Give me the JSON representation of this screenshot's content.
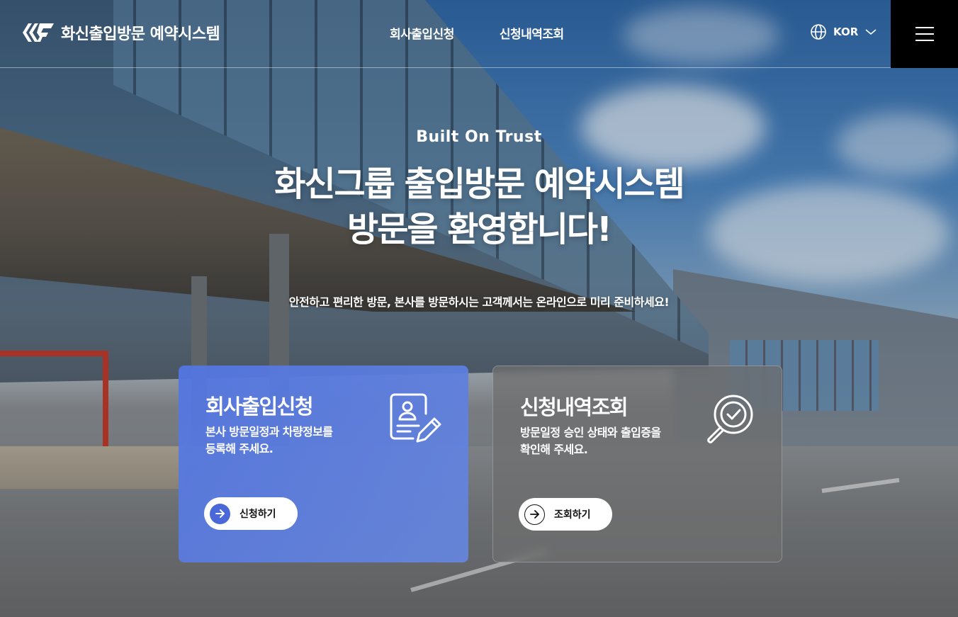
{
  "header": {
    "logo_text": "화신출입방문 예약시스템",
    "nav": [
      {
        "label": "회사출입신청"
      },
      {
        "label": "신청내역조회"
      }
    ],
    "language": {
      "label": "KOR",
      "icon": "globe-icon"
    },
    "menu_icon": "hamburger-menu-icon"
  },
  "hero": {
    "eyebrow": "Built On Trust",
    "title_line1": "화신그룹 출입방문 예약시스템",
    "title_line2": "방문을 환영합니다!",
    "subtitle": "안전하고 편리한 방문, 본사를 방문하시는 고객께서는 온라인으로 미리 준비하세요!"
  },
  "cards": [
    {
      "title": "회사출입신청",
      "description": "본사 방문일정과 차량정보를\n등록해 주세요.",
      "button_label": "신청하기",
      "icon": "document-edit-icon",
      "color": "#5a7ae0"
    },
    {
      "title": "신청내역조회",
      "description": "방문일정 승인 상태와 출입증을\n확인해 주세요.",
      "button_label": "조회하기",
      "icon": "search-check-icon",
      "color": "#6e6e6e"
    }
  ]
}
